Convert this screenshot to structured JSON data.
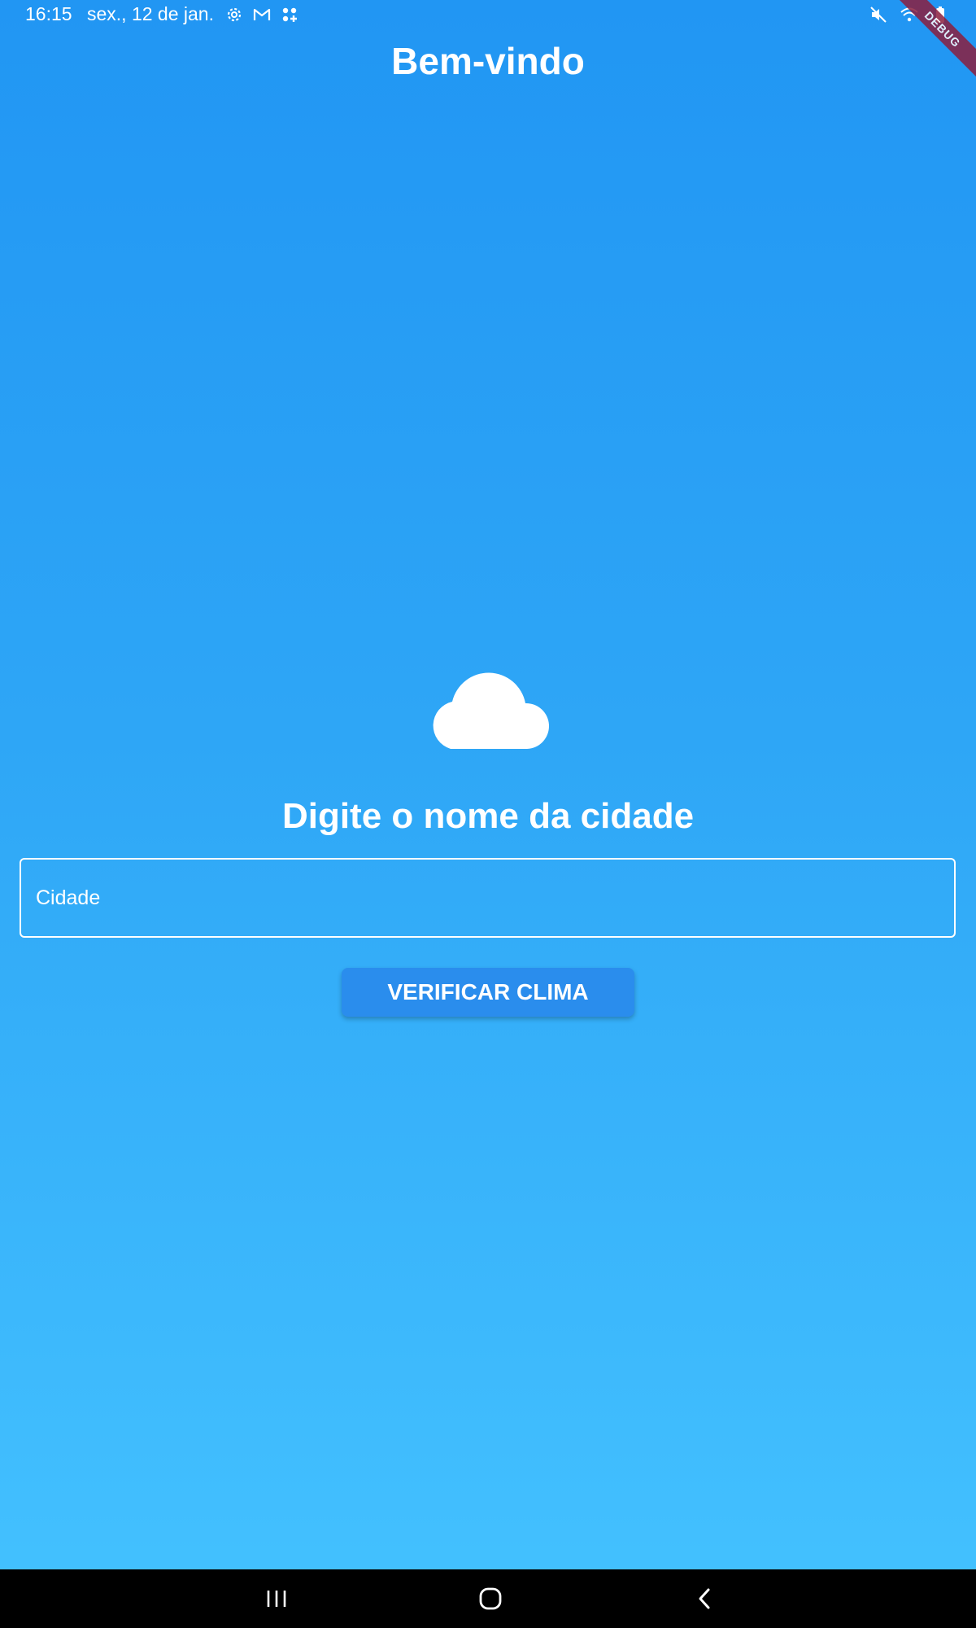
{
  "status_bar": {
    "time": "16:15",
    "date": "sex., 12 de jan.",
    "left_icons": [
      "settings-icon",
      "gmail-icon",
      "app-grid-icon"
    ],
    "right_icons": [
      "mute-icon",
      "wifi-icon",
      "battery-icon"
    ]
  },
  "debug_banner": {
    "label": "DEBUG"
  },
  "app_bar": {
    "title": "Bem-vindo"
  },
  "main": {
    "icon": "cloud-icon",
    "prompt": "Digite o nome da cidade",
    "city_field": {
      "placeholder": "Cidade",
      "value": ""
    },
    "button_label": "VERIFICAR CLIMA"
  },
  "nav_bar": {
    "buttons": [
      "recent-apps-icon",
      "home-icon",
      "back-icon"
    ]
  },
  "colors": {
    "gradient_top": "#2196f3",
    "gradient_bottom": "#44c2ff",
    "button": "#2a8ded",
    "debug": "#8b1f3f"
  }
}
